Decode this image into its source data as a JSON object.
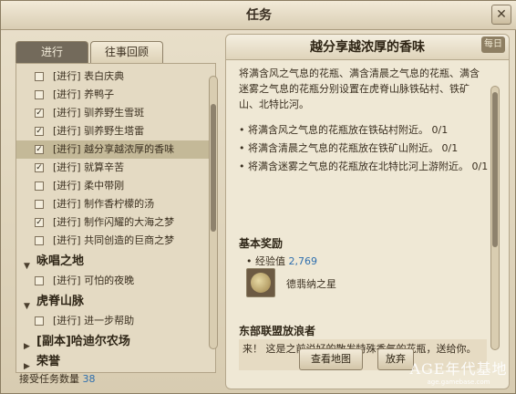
{
  "window": {
    "title": "任务",
    "close_icon": "close-icon"
  },
  "tabs": {
    "active": "进行",
    "inactive": "往事回顾"
  },
  "quests": [
    {
      "label": "[进行] 表白庆典",
      "checked": false
    },
    {
      "label": "[进行] 养鸭子",
      "checked": false
    },
    {
      "label": "[进行] 驯养野生雪斑",
      "checked": true
    },
    {
      "label": "[进行] 驯养野生塔雷",
      "checked": true
    },
    {
      "label": "[进行] 越分享越浓厚的香味",
      "checked": true,
      "selected": true
    },
    {
      "label": "[进行] 就算辛苦",
      "checked": true
    },
    {
      "label": "[进行] 柔中带刚",
      "checked": false
    },
    {
      "label": "[进行] 制作香柠檬的汤",
      "checked": false
    },
    {
      "label": "[进行] 制作闪耀的大海之梦",
      "checked": true
    },
    {
      "label": "[进行] 共同创造的巨商之梦",
      "checked": false
    }
  ],
  "groups": [
    {
      "name": "咏唱之地",
      "items": [
        "[进行] 可怕的夜晚"
      ]
    },
    {
      "name": "虎脊山脉",
      "items": [
        "[进行] 进一步帮助"
      ]
    },
    {
      "name": "[副本]哈迪尔农场",
      "items": []
    },
    {
      "name": "荣誉",
      "items": []
    }
  ],
  "accept_count": {
    "label": "接受任务数量",
    "value": "38"
  },
  "quest_detail": {
    "title": "越分享越浓厚的香味",
    "daily_badge": "每日",
    "description": "将满含风之气息的花瓶、满含清晨之气息的花瓶、满含迷雾之气息的花瓶分别设置在虎脊山脉铁砧村、铁矿山、北特比河。",
    "objectives": [
      "将满含风之气息的花瓶放在铁砧村附近。 0/1",
      "将满含清晨之气息的花瓶放在铁矿山附近。 0/1",
      "将满含迷雾之气息的花瓶放在北特比河上游附近。 0/1"
    ],
    "reward_header": "基本奖励",
    "exp_label": "经验值",
    "exp_value": "2,769",
    "reward_item_name": "德翡纳之星",
    "npc_name": "东部联盟放浪者",
    "npc_text": "来！ 这是之前说好的散发特殊香气的花瓶，送给你。"
  },
  "buttons": {
    "view_map": "查看地图",
    "abandon": "放弃"
  },
  "watermark": {
    "main": "AGE年代基地",
    "sub": "age.gamebase.com"
  },
  "colors": {
    "accent_blue": "#2f6fae",
    "tab_active": "#736a5b",
    "selected_row": "#c4b998"
  }
}
